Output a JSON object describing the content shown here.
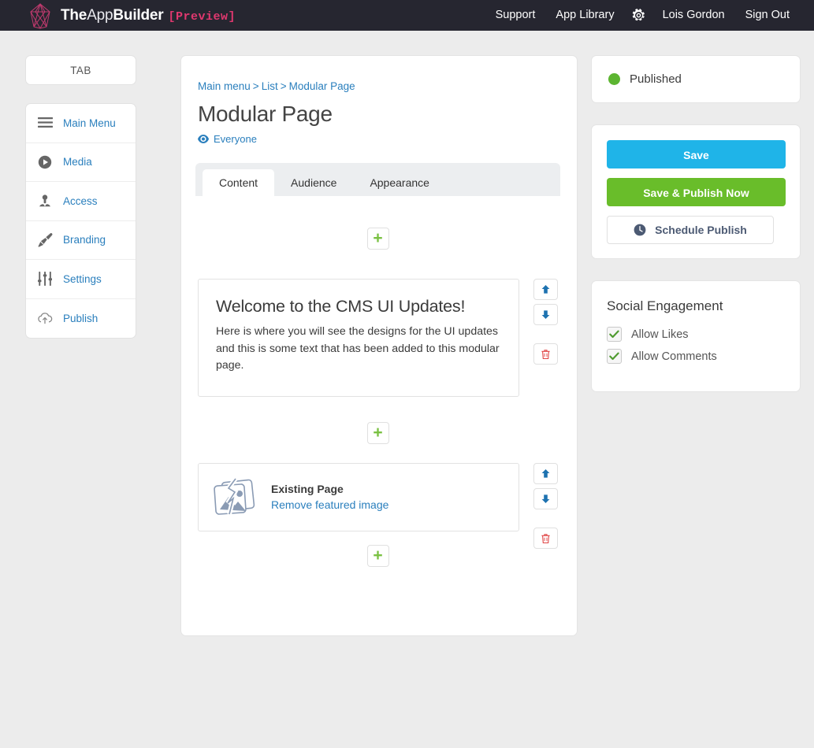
{
  "topbar": {
    "logo_icon": "gem-logo-icon",
    "brand_the": "The",
    "brand_app": "App",
    "brand_builder": "Builder",
    "brand_preview": "[Preview]",
    "nav": [
      {
        "label": "Support",
        "name": "support"
      },
      {
        "label": "App Library",
        "name": "app-library"
      }
    ],
    "gear_icon": "gear-icon",
    "user_name": "Lois Gordon",
    "sign_out": "Sign Out",
    "bg_color": "#262630",
    "preview_color": "#e0386f"
  },
  "sidebar": {
    "tab_label": "TAB",
    "items": [
      {
        "label": "Main Menu",
        "icon": "hamburger-icon"
      },
      {
        "label": "Media",
        "icon": "play-circle-icon"
      },
      {
        "label": "Access",
        "icon": "user-access-icon"
      },
      {
        "label": "Branding",
        "icon": "paintbrush-icon"
      },
      {
        "label": "Settings",
        "icon": "sliders-icon"
      },
      {
        "label": "Publish",
        "icon": "cloud-upload-icon"
      }
    ],
    "link_color": "#2a7fbd"
  },
  "main": {
    "breadcrumb": {
      "items": [
        "Main menu",
        "List",
        "Modular Page"
      ],
      "separator": ">"
    },
    "title": "Modular Page",
    "audience": {
      "icon": "eye-icon",
      "label": "Everyone"
    },
    "tabs": [
      {
        "label": "Content",
        "active": true
      },
      {
        "label": "Audience",
        "active": false
      },
      {
        "label": "Appearance",
        "active": false
      }
    ],
    "add_button_label": "+",
    "blocks": [
      {
        "type": "text",
        "title": "Welcome to the CMS UI Updates!",
        "body": "Here is where you will see the designs for the UI updates and this is some text that has been added to this modular page.",
        "controls": {
          "up": "arrow-up-icon",
          "down": "arrow-down-icon",
          "delete": "trash-icon"
        }
      },
      {
        "type": "image",
        "thumb_icon": "broken-image-icon",
        "name": "Existing Page",
        "remove_label": "Remove featured image",
        "controls": {
          "up": "arrow-up-icon",
          "down": "arrow-down-icon",
          "delete": "trash-icon"
        }
      }
    ]
  },
  "rightbar": {
    "status": {
      "label": "Published",
      "dot_color": "#5cb531"
    },
    "actions": {
      "save_label": "Save",
      "save_color": "#1fb4e8",
      "publish_label": "Save & Publish Now",
      "publish_color": "#69bd2a",
      "schedule_label": "Schedule Publish",
      "schedule_icon": "clock-icon"
    },
    "social": {
      "title": "Social Engagement",
      "options": [
        {
          "label": "Allow Likes",
          "checked": true
        },
        {
          "label": "Allow Comments",
          "checked": true
        }
      ],
      "check_color": "#4e9a2e"
    }
  }
}
